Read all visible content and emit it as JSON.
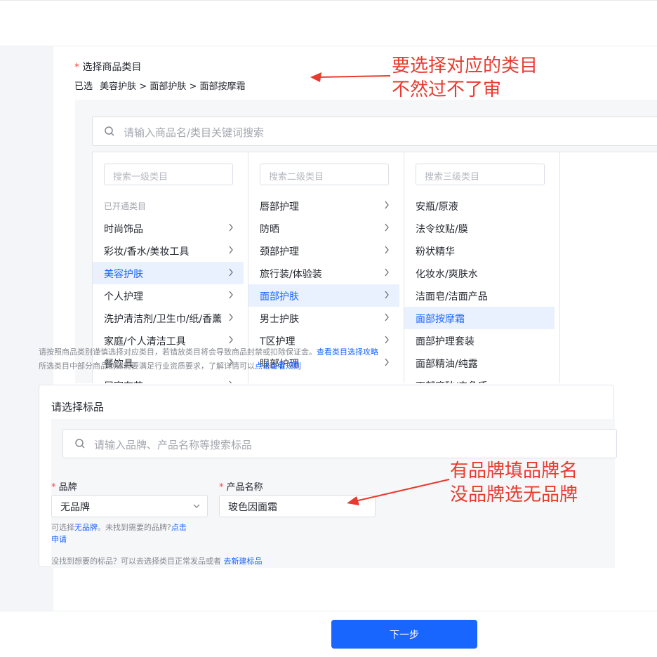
{
  "category_section": {
    "required_mark": "*",
    "title": "选择商品类目",
    "selected_prefix": "已选",
    "selected_path": "美容护肤 > 面部护肤 > 面部按摩霜",
    "search_placeholder": "请输入商品名/类目关键词搜索",
    "columns": [
      {
        "filter_placeholder": "搜索一级类目",
        "group_label": "已开通类目",
        "items": [
          {
            "label": "时尚饰品",
            "active": false
          },
          {
            "label": "彩妆/香水/美妆工具",
            "active": false
          },
          {
            "label": "美容护肤",
            "active": true
          },
          {
            "label": "个人护理",
            "active": false
          },
          {
            "label": "洗护清洁剂/卫生巾/纸/香薰",
            "active": false
          },
          {
            "label": "家庭/个人清洁工具",
            "active": false
          },
          {
            "label": "餐饮具",
            "active": false
          },
          {
            "label": "居家布艺",
            "active": false
          }
        ]
      },
      {
        "filter_placeholder": "搜索二级类目",
        "items": [
          {
            "label": "唇部护理",
            "active": false
          },
          {
            "label": "防晒",
            "active": false
          },
          {
            "label": "颈部护理",
            "active": false
          },
          {
            "label": "旅行装/体验装",
            "active": false
          },
          {
            "label": "面部护肤",
            "active": true
          },
          {
            "label": "男士护肤",
            "active": false
          },
          {
            "label": "T区护理",
            "active": false
          },
          {
            "label": "眼部护理",
            "active": false
          }
        ]
      },
      {
        "filter_placeholder": "搜索三级类目",
        "items": [
          {
            "label": "安瓶/原液",
            "active": false
          },
          {
            "label": "法令纹贴/膜",
            "active": false
          },
          {
            "label": "粉状精华",
            "active": false
          },
          {
            "label": "化妆水/爽肤水",
            "active": false
          },
          {
            "label": "洁面皂/洁面产品",
            "active": false
          },
          {
            "label": "面部按摩霜",
            "active": true
          },
          {
            "label": "面部护理套装",
            "active": false
          },
          {
            "label": "面部精油/纯露",
            "active": false
          },
          {
            "label": "面部磨砂/去角质",
            "active": false
          }
        ]
      }
    ],
    "note_line1": "请按照商品类别谨慎选择对应类目，若错放类目将会导致商品封禁或扣除保证金。",
    "note_line1_link": "查看类目选择攻略",
    "note_line2": "所选类目中部分商品创建需要满足行业资质要求，了解详情可以",
    "note_line2_link": "点击查看规则"
  },
  "standard_product": {
    "title": "请选择标品",
    "search_placeholder": "请输入品牌、产品名称等搜索标品",
    "brand_label": "品牌",
    "brand_value": "无品牌",
    "product_label": "产品名称",
    "product_value": "玻色因面霜",
    "hint_prefix": "可选择",
    "hint_link1": "无品牌",
    "hint_mid": "。未找到需要的品牌?",
    "hint_link2a": "点击",
    "hint_link2b": "申请",
    "bottom_text": "没找到想要的标品？可以去选择类目正常发品或者",
    "bottom_link": "去新建标品"
  },
  "annotations": {
    "top_line1": "要选择对应的类目",
    "top_line2": "不然过不了审",
    "mid_line1": "有品牌填品牌名",
    "mid_line2": "没品牌选无品牌",
    "color": "#e83a2e"
  },
  "footer": {
    "next_label": "下一步"
  },
  "colors": {
    "accent": "#1966ff",
    "active_bg": "#eaf1fe",
    "required": "#f54a45"
  }
}
